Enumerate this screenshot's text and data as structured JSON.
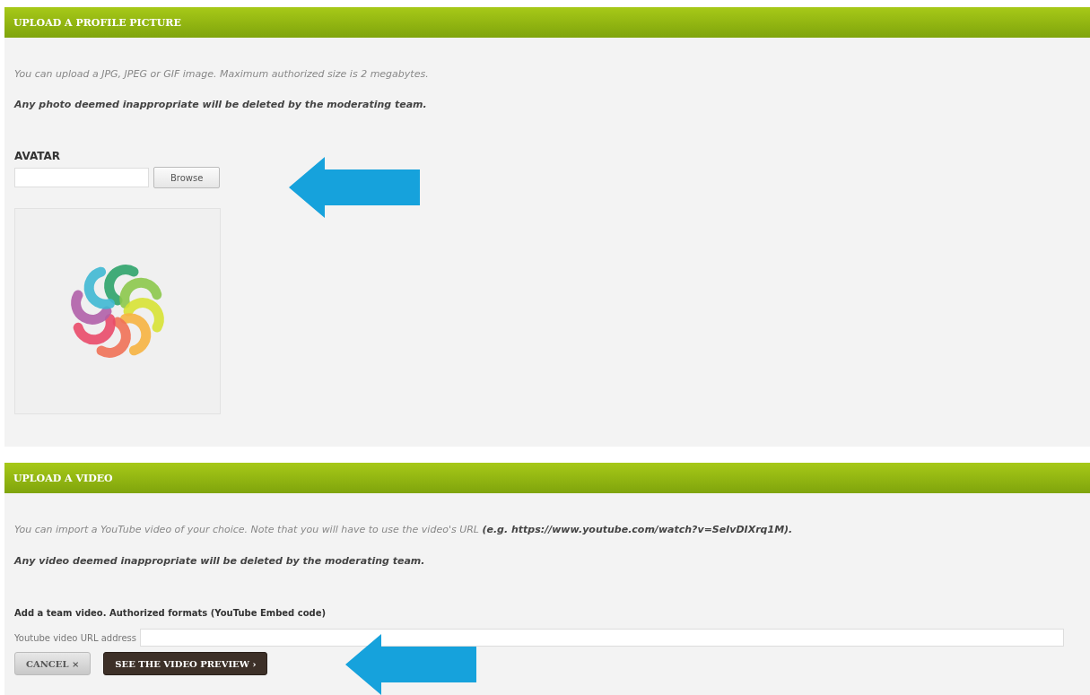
{
  "profile_section": {
    "title": "UPLOAD A PROFILE PICTURE",
    "info": "You can upload a JPG, JPEG or GIF image. Maximum authorized size is 2 megabytes.",
    "warning": "Any photo deemed inappropriate will be deleted by the moderating team.",
    "avatar_label": "AVATAR",
    "browse_button": "Browse"
  },
  "video_section": {
    "title": "UPLOAD A VIDEO",
    "info": "You can import a YouTube video of your choice. Note that you will have to use the video's URL **(e.g. https://www.youtube.com/watch?v=SeIvDIXrq1M).**",
    "warning": "Any video deemed inappropriate will be deleted by the moderating team.",
    "form_label": "Add a team video. Authorized formats (YouTube Embed code)",
    "url_label": "Youtube video URL address",
    "buttons": [
      {
        "label": "CANCEL ×",
        "kind": "secondary"
      },
      {
        "label": "SEE THE VIDEO PREVIEW ›",
        "kind": "primary"
      }
    ]
  }
}
